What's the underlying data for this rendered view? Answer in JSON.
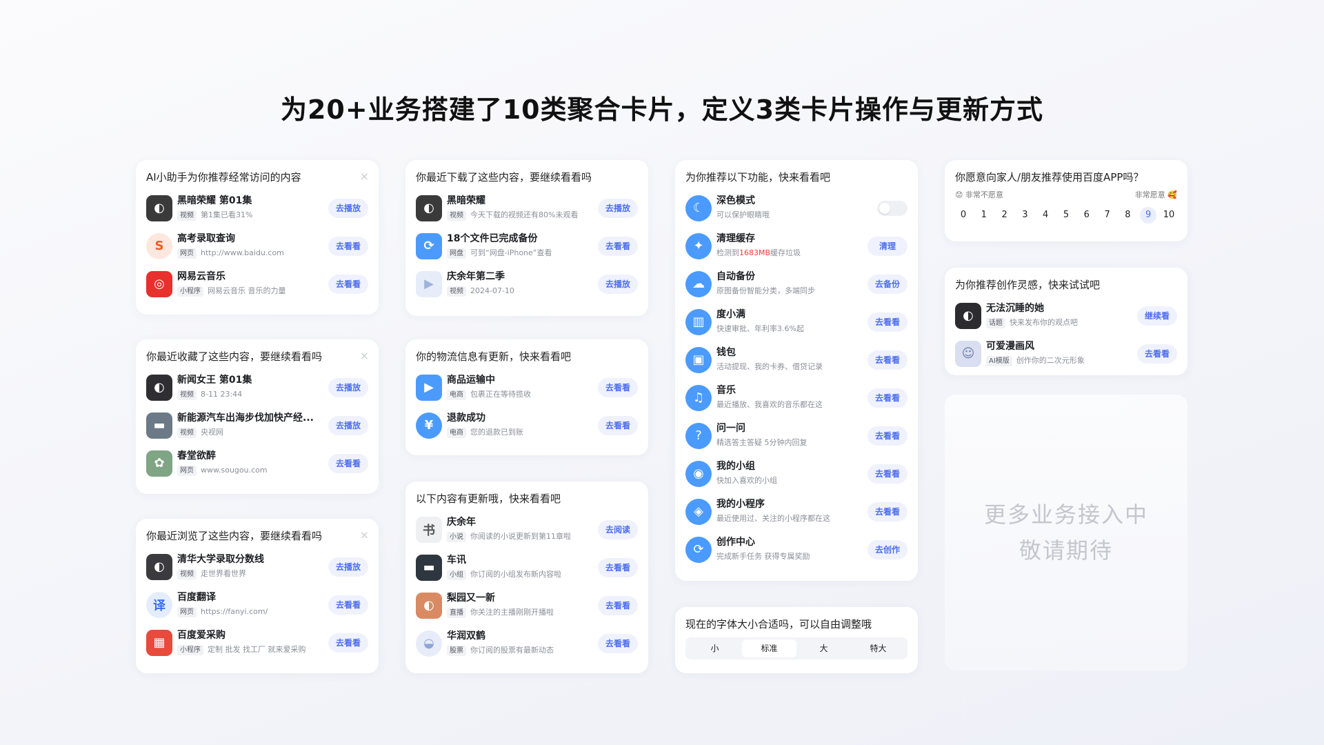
{
  "page_title": "为20+业务搭建了10类聚合卡片，定义3类卡片操作与更新方式",
  "close_glyph": "×",
  "col1": [
    {
      "title": "AI小助手为你推荐经常访问的内容",
      "rows": [
        {
          "name": "黑暗荣耀 第01集",
          "tag": "视频",
          "sub": "第1集已看31%",
          "btn": "去播放"
        },
        {
          "name": "高考录取查询",
          "tag": "网页",
          "sub": "http://www.baidu.com",
          "btn": "去看看"
        },
        {
          "name": "网易云音乐",
          "tag": "小程序",
          "sub": "网易云音乐 音乐的力量",
          "btn": "去看看"
        }
      ]
    },
    {
      "title": "你最近收藏了这些内容，要继续看看吗",
      "rows": [
        {
          "name": "新闻女王 第01集",
          "tag": "视频",
          "sub": "8-11 23:44",
          "btn": "去播放"
        },
        {
          "name": "新能源汽车出海步伐加快产经...",
          "tag": "视频",
          "sub": "央视网",
          "btn": "去播放"
        },
        {
          "name": "春堂欲醉",
          "tag": "网页",
          "sub": "www.sougou.com",
          "btn": "去看看"
        }
      ]
    },
    {
      "title": "你最近浏览了这些内容，要继续看看吗",
      "rows": [
        {
          "name": "清华大学录取分数线",
          "tag": "视频",
          "sub": "走世界看世界",
          "btn": "去播放"
        },
        {
          "name": "百度翻译",
          "tag": "网页",
          "sub": "https://fanyi.com/",
          "btn": "去看看"
        },
        {
          "name": "百度爱采购",
          "tag": "小程序",
          "sub": "定制 批发 找工厂 就来爱采购",
          "btn": "去看看"
        }
      ]
    }
  ],
  "col2": [
    {
      "title": "你最近下载了这些内容，要继续看看吗",
      "rows": [
        {
          "name": "黑暗荣耀",
          "tag": "视频",
          "sub": "今天下载的视频还有80%未观看",
          "btn": "去播放"
        },
        {
          "name": "18个文件已完成备份",
          "tag": "网盘",
          "sub": "可到“网盘-iPhone”查看",
          "btn": "去看看"
        },
        {
          "name": "庆余年第二季",
          "tag": "视频",
          "sub": "2024-07-10",
          "btn": "去播放"
        }
      ]
    },
    {
      "title": "你的物流信息有更新，快来看看吧",
      "rows": [
        {
          "name": "商品运输中",
          "tag": "电商",
          "sub": "包裹正在等待揽收",
          "btn": "去看看"
        },
        {
          "name": "退款成功",
          "tag": "电商",
          "sub": "您的退款已到账",
          "btn": "去看看"
        }
      ]
    },
    {
      "title": "以下内容有更新哦，快来看看吧",
      "rows": [
        {
          "name": "庆余年",
          "tag": "小说",
          "sub": "你阅读的小说更新到第11章啦",
          "btn": "去阅读"
        },
        {
          "name": "车讯",
          "tag": "小组",
          "sub": "你订阅的小组发布新内容啦",
          "btn": "去看看"
        },
        {
          "name": "梨园又一新",
          "tag": "直播",
          "sub": "你关注的主播刚刚开播啦",
          "btn": "去看看"
        },
        {
          "name": "华润双鹤",
          "tag": "股票",
          "sub": "你订阅的股票有最新动态",
          "btn": "去看看"
        }
      ]
    }
  ],
  "col3": {
    "features_title": "为你推荐以下功能，快来看看吧",
    "features": [
      {
        "name": "深色模式",
        "sub": "可以保护眼睛哦",
        "icon": "moon-icon",
        "glyph": "☾",
        "btn": ""
      },
      {
        "name": "清理缓存",
        "sub_pre": "检测到",
        "sub_hl": "1683MB",
        "sub_post": "缓存垃圾",
        "icon": "broom-icon",
        "glyph": "✦",
        "btn": "清理"
      },
      {
        "name": "自动备份",
        "sub": "原图备份智能分类，多端同步",
        "icon": "cloud-icon",
        "glyph": "☁",
        "btn": "去备份"
      },
      {
        "name": "度小满",
        "sub": "快速审批、年利率3.6%起",
        "icon": "chart-icon",
        "glyph": "▥",
        "btn": "去看看"
      },
      {
        "name": "钱包",
        "sub": "活动提现、我的卡券、借贷记录",
        "icon": "wallet-icon",
        "glyph": "▣",
        "btn": "去看看"
      },
      {
        "name": "音乐",
        "sub": "最近播放、我喜欢的音乐都在这",
        "icon": "music-icon",
        "glyph": "♫",
        "btn": "去看看"
      },
      {
        "name": "问一问",
        "sub": "精选答主答疑 5分钟内回复",
        "icon": "question-icon",
        "glyph": "?",
        "btn": "去看看"
      },
      {
        "name": "我的小组",
        "sub": "快加入喜欢的小组",
        "icon": "group-icon",
        "glyph": "◉",
        "btn": "去看看"
      },
      {
        "name": "我的小程序",
        "sub": "最近使用过、关注的小程序都在这",
        "icon": "miniprogram-icon",
        "glyph": "◈",
        "btn": "去看看"
      },
      {
        "name": "创作中心",
        "sub": "完成新手任务 获得专属奖励",
        "icon": "create-icon",
        "glyph": "⟳",
        "btn": "去创作"
      }
    ],
    "font_title": "现在的字体大小合适吗，可以自由调整哦",
    "font_options": [
      "小",
      "标准",
      "大",
      "特大"
    ],
    "font_selected": "标准"
  },
  "col4": {
    "nps_title": "你愿意向家人/朋友推荐使用百度APP吗？",
    "nps_low": "😟 非常不愿意",
    "nps_high": "非常愿意 🥰",
    "nps_scale": [
      "0",
      "1",
      "2",
      "3",
      "4",
      "5",
      "6",
      "7",
      "8",
      "9",
      "10"
    ],
    "nps_selected": "9",
    "inspire_title": "为你推荐创作灵感，快来试试吧",
    "inspire_rows": [
      {
        "name": "无法沉睡的她",
        "tag": "话题",
        "sub": "快来发布你的观点吧",
        "btn": "继续看"
      },
      {
        "name": "可爱漫画风",
        "tag": "AI模版",
        "sub": "创作你的二次元形象",
        "btn": "去看看"
      }
    ],
    "placeholder_line1": "更多业务接入中",
    "placeholder_line2": "敬请期待"
  },
  "colors": {
    "accent": "#4e6ef2",
    "feature_icon": "#4b9bff",
    "highlight": "#f23d3d"
  }
}
